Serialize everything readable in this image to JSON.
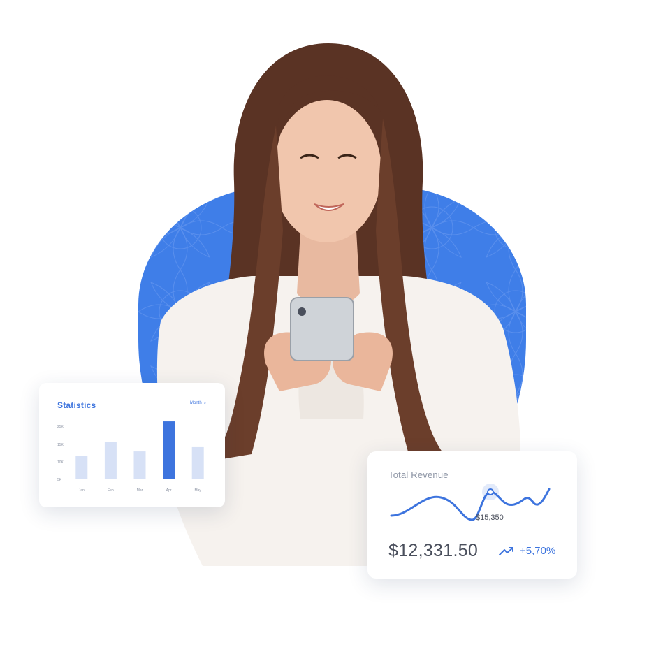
{
  "colors": {
    "accent": "#3d74de",
    "blob": "#3f7ee8",
    "bar_muted": "#d7e1f6",
    "bar_highlight": "#3d74de"
  },
  "statistics_card": {
    "title": "Statistics",
    "filter_label": "Month",
    "filter_icon": "chevron-down-icon",
    "chart_data": {
      "type": "bar",
      "categories": [
        "Jan",
        "Feb",
        "Mar",
        "Apr",
        "May"
      ],
      "values": [
        11,
        17.5,
        13,
        27,
        15
      ],
      "y_ticks": [
        "25K",
        "15K",
        "10K",
        "5K"
      ],
      "highlight_index": 3
    }
  },
  "revenue_card": {
    "title": "Total Revenue",
    "amount": "$12,331.50",
    "change": "+5,70%",
    "change_icon": "trending-up-icon",
    "peak_label": "$15,350"
  }
}
